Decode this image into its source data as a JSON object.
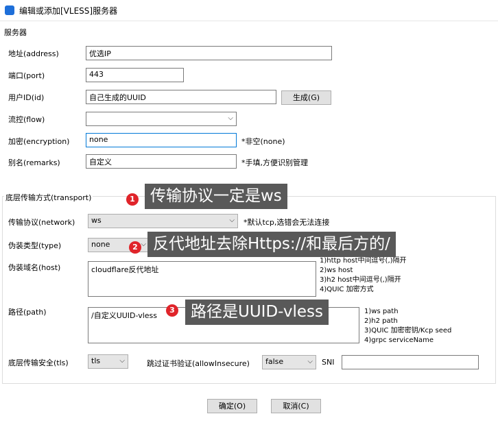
{
  "window": {
    "title": "编辑或添加[VLESS]服务器"
  },
  "server_section": {
    "heading": "服务器",
    "address_label": "地址(address)",
    "address_value": "优选IP",
    "port_label": "端口(port)",
    "port_value": "443",
    "id_label": "用户ID(id)",
    "id_value": "自己生成的UUID",
    "generate_button": "生成(G)",
    "flow_label": "流控(flow)",
    "flow_value": "",
    "encryption_label": "加密(encryption)",
    "encryption_value": "none",
    "encryption_hint": "*非空(none)",
    "remarks_label": "别名(remarks)",
    "remarks_value": "自定义",
    "remarks_hint": "*手填,方便识别管理"
  },
  "transport_section": {
    "heading": "底层传输方式(transport)",
    "network_label": "传输协议(network)",
    "network_value": "ws",
    "network_hint": "*默认tcp,选错会无法连接",
    "type_label": "伪装类型(type)",
    "type_value": "none",
    "host_label": "伪装域名(host)",
    "host_value": "cloudflare反代地址",
    "host_hints": [
      "1)http host中间逗号(,)隔开",
      "2)ws host",
      "3)h2 host中间逗号(,)隔开",
      "4)QUIC 加密方式"
    ],
    "path_label": "路径(path)",
    "path_value": "/自定义UUID-vless",
    "path_hints": [
      "1)ws path",
      "2)h2 path",
      "3)QUIC 加密密钥/Kcp seed",
      "4)grpc serviceName"
    ],
    "tls_label": "底层传输安全(tls)",
    "tls_value": "tls",
    "allow_insecure_label": "跳过证书验证(allowInsecure)",
    "allow_insecure_value": "false",
    "sni_label": "SNI",
    "sni_value": ""
  },
  "footer": {
    "ok_button": "确定(O)",
    "cancel_button": "取消(C)"
  },
  "annotations": [
    {
      "number": "1",
      "text": "传输协议一定是ws"
    },
    {
      "number": "2",
      "text": "反代地址去除Https://和最后方的/"
    },
    {
      "number": "3",
      "text": "路径是UUID-vless"
    }
  ],
  "icons": {
    "app": "v2rayn-app-icon",
    "dropdown": "chevron-down-icon"
  },
  "colors": {
    "callout_bg": "#595959",
    "badge_red": "#e0242a",
    "focus_border": "#0078d7"
  }
}
